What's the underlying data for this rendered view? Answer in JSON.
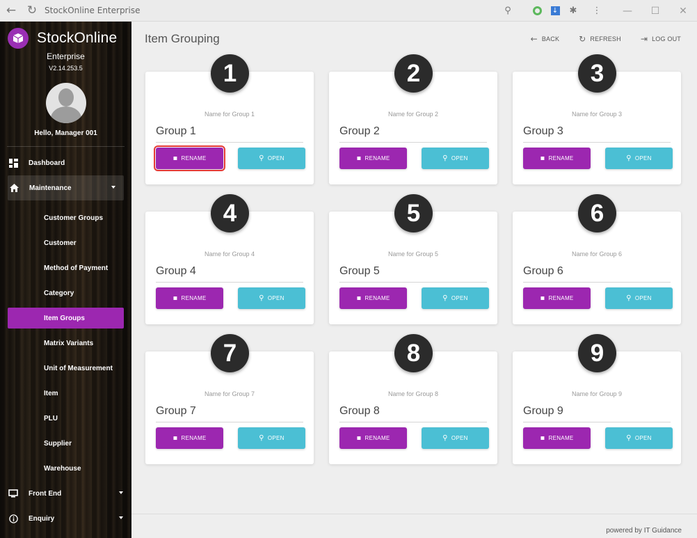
{
  "window": {
    "title": "StockOnline Enterprise"
  },
  "sidebar": {
    "brand": "StockOnline",
    "edition": "Enterprise",
    "version": "V2.14.253.5",
    "greeting": "Hello, Manager 001",
    "nav": {
      "dashboard": "Dashboard",
      "maintenance": "Maintenance",
      "sub_items": [
        "Customer Groups",
        "Customer",
        "Method of Payment",
        "Category",
        "Item Groups",
        "Matrix Variants",
        "Unit of Measurement",
        "Item",
        "PLU",
        "Supplier",
        "Warehouse"
      ],
      "front_end": "Front End",
      "enquiry": "Enquiry"
    }
  },
  "header": {
    "title": "Item Grouping",
    "back": "BACK",
    "refresh": "REFRESH",
    "logout": "LOG OUT"
  },
  "groups": [
    {
      "number": "1",
      "label": "Name for Group 1",
      "value": "Group 1"
    },
    {
      "number": "2",
      "label": "Name for Group 2",
      "value": "Group 2"
    },
    {
      "number": "3",
      "label": "Name for Group 3",
      "value": "Group 3"
    },
    {
      "number": "4",
      "label": "Name for Group 4",
      "value": "Group 4"
    },
    {
      "number": "5",
      "label": "Name for Group 5",
      "value": "Group 5"
    },
    {
      "number": "6",
      "label": "Name for Group 6",
      "value": "Group 6"
    },
    {
      "number": "7",
      "label": "Name for Group 7",
      "value": "Group 7"
    },
    {
      "number": "8",
      "label": "Name for Group 8",
      "value": "Group 8"
    },
    {
      "number": "9",
      "label": "Name for Group 9",
      "value": "Group 9"
    }
  ],
  "buttons": {
    "rename": "RENAME",
    "open": "OPEN"
  },
  "footer": "powered by IT Guidance",
  "colors": {
    "accent": "#9c27b0",
    "open": "#4bbfd4",
    "highlight": "#e53935"
  }
}
